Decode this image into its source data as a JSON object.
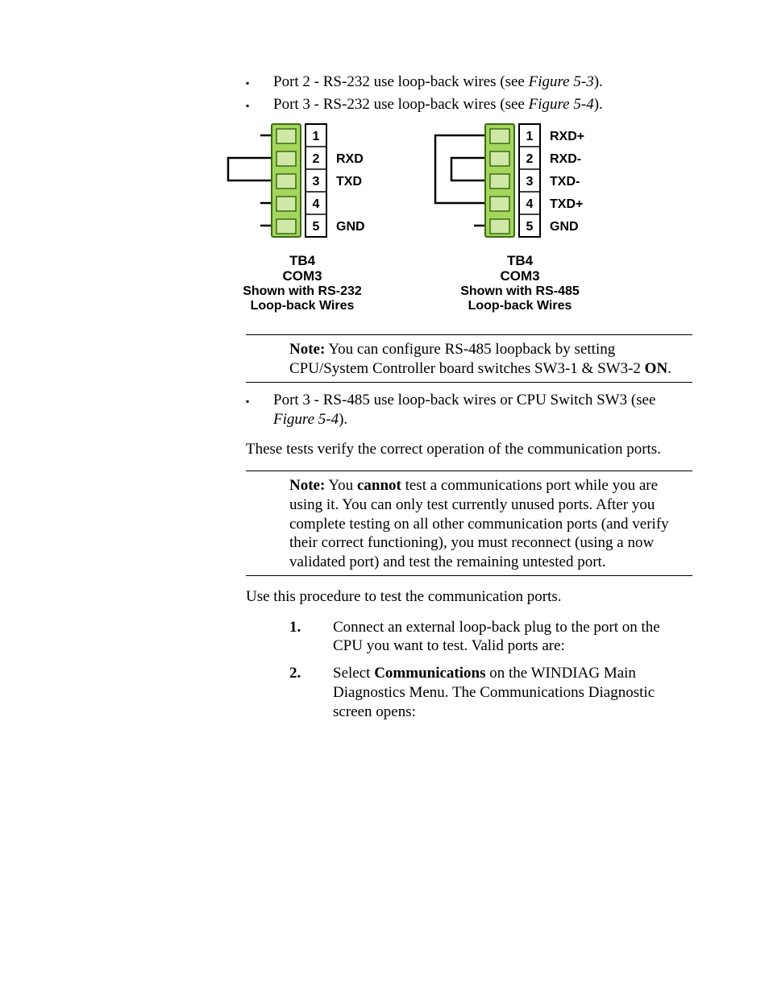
{
  "bullets": {
    "p2": {
      "text": "Port 2 - RS-232 use loop-back wires (see ",
      "fig": "Figure 5-3",
      "close": ")."
    },
    "p3": {
      "text": "Port 3 - RS-232 use loop-back wires (see ",
      "fig": "Figure 5-4",
      "close": ")."
    },
    "p3b": {
      "text": "Port 3 - RS-485 use loop-back wires or CPU Switch SW3 (see ",
      "fig": "Figure 5-4",
      "close": ")."
    }
  },
  "figure": {
    "left": {
      "pins": [
        "1",
        "2",
        "3",
        "4",
        "5"
      ],
      "labels": [
        "",
        "RXD",
        "TXD",
        "",
        "GND"
      ],
      "caption1": "TB4",
      "caption2": "COM3",
      "caption3": "Shown with RS-232",
      "caption4": "Loop-back Wires"
    },
    "right": {
      "pins": [
        "1",
        "2",
        "3",
        "4",
        "5"
      ],
      "labels": [
        "RXD+",
        "RXD-",
        "TXD-",
        "TXD+",
        "GND"
      ],
      "caption1": "TB4",
      "caption2": "COM3",
      "caption3": "Shown with RS-485",
      "caption4": "Loop-back Wires"
    }
  },
  "note1": {
    "label": "Note:",
    "text_a": "You can configure RS-485 loopback by setting CPU/System Controller board switches SW3-1 & SW3-2 ",
    "on": "ON",
    "text_b": "."
  },
  "intro": "These tests verify the correct operation of the communication ports.",
  "note2": {
    "label": "Note:",
    "text_a": "You ",
    "cannot": "cannot",
    "text_b": " test a communications port while you are using it. You can only test currently unused ports. After you complete testing on all other communication ports (and verify their correct functioning), you must reconnect (using a now validated port) and test the remaining untested port."
  },
  "procedure_intro": "Use this procedure to test the communication ports.",
  "steps": {
    "s1": {
      "num": "1.",
      "text": "Connect an external loop-back plug to the port on the CPU you want to test. Valid ports are:"
    },
    "s2": {
      "num": "2.",
      "text_a": "Select ",
      "menu": "Communications",
      "text_b": " on the WINDIAG Main Diagnostics Menu. The Communications Diagnostic screen opens:"
    }
  }
}
